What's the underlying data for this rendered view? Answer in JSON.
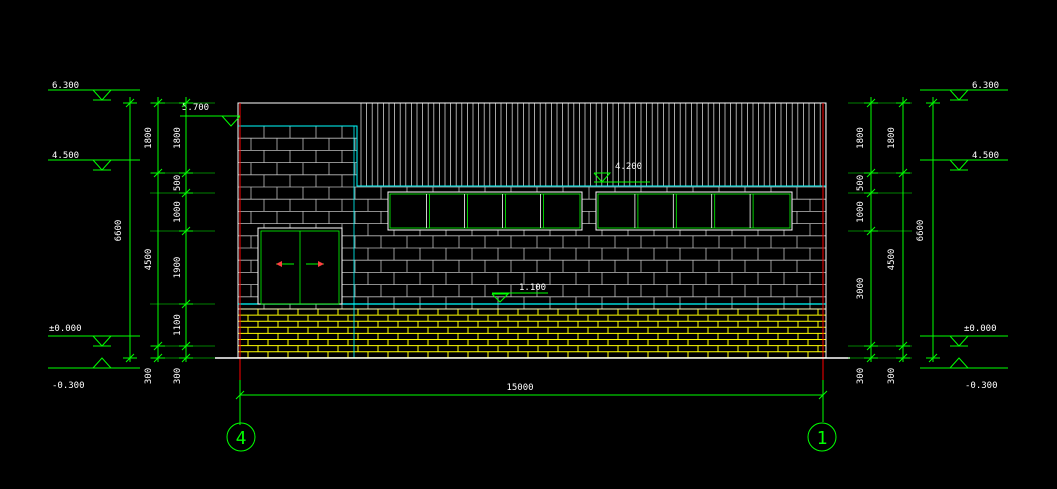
{
  "colors": {
    "background": "#000000",
    "dimension": "#00ff00",
    "text": "#ffffff",
    "wall_lines": "#d8d8d8",
    "window": "#00ff00",
    "axis_red": "#ff0000",
    "brick_base": "#ffff00",
    "cyan": "#00ffff"
  },
  "levels": {
    "left": {
      "top": "6.300",
      "upper": "4.500",
      "ground": "±0.000",
      "bottom": "-0.300",
      "parapet": "5.700"
    },
    "right": {
      "top": "6.300",
      "upper": "4.500",
      "ground": "±0.000",
      "bottom": "-0.300"
    },
    "facade": {
      "window_head": "4.200",
      "window_sill": "1.100"
    }
  },
  "dimensions": {
    "left_inner": [
      "1800",
      "500",
      "1000",
      "1900",
      "1100",
      "300"
    ],
    "left_middle": [
      "1800",
      "4500",
      "300"
    ],
    "left_total": "6600",
    "right_inner": [
      "1800",
      "500",
      "1000",
      "3000",
      "300"
    ],
    "right_middle": [
      "1800",
      "4500",
      "300"
    ],
    "right_total": "6600",
    "horizontal": "15000"
  },
  "axes": {
    "left": "4",
    "right": "1"
  }
}
